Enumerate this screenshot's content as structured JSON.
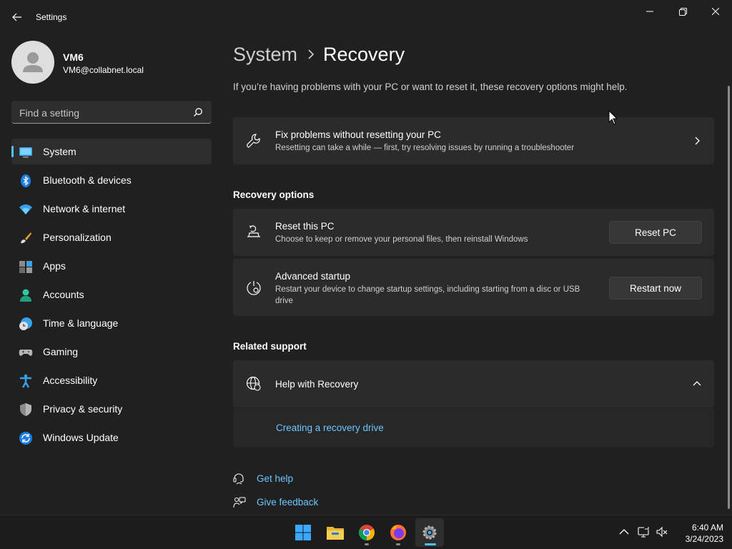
{
  "app": {
    "title": "Settings"
  },
  "profile": {
    "name": "VM6",
    "email": "VM6@collabnet.local"
  },
  "search": {
    "placeholder": "Find a setting"
  },
  "sidebar": {
    "items": [
      {
        "label": "System",
        "icon": "system-icon",
        "active": true
      },
      {
        "label": "Bluetooth & devices",
        "icon": "bluetooth-icon"
      },
      {
        "label": "Network & internet",
        "icon": "wifi-icon"
      },
      {
        "label": "Personalization",
        "icon": "brush-icon"
      },
      {
        "label": "Apps",
        "icon": "apps-icon"
      },
      {
        "label": "Accounts",
        "icon": "accounts-icon"
      },
      {
        "label": "Time & language",
        "icon": "clock-globe-icon"
      },
      {
        "label": "Gaming",
        "icon": "gamepad-icon"
      },
      {
        "label": "Accessibility",
        "icon": "accessibility-icon"
      },
      {
        "label": "Privacy & security",
        "icon": "shield-icon"
      },
      {
        "label": "Windows Update",
        "icon": "update-icon"
      }
    ]
  },
  "breadcrumb": {
    "parent": "System",
    "current": "Recovery"
  },
  "main": {
    "intro": "If you’re having problems with your PC or want to reset it, these recovery options might help.",
    "fix_card": {
      "title": "Fix problems without resetting your PC",
      "description": "Resetting can take a while — first, try resolving issues by running a troubleshooter"
    },
    "recovery_options_heading": "Recovery options",
    "reset_card": {
      "title": "Reset this PC",
      "description": "Choose to keep or remove your personal files, then reinstall Windows",
      "button": "Reset PC"
    },
    "advanced_card": {
      "title": "Advanced startup",
      "description": "Restart your device to change startup settings, including starting from a disc or USB drive",
      "button": "Restart now"
    },
    "related_support_heading": "Related support",
    "help_card": {
      "title": "Help with Recovery",
      "link": "Creating a recovery drive"
    },
    "footer": {
      "get_help": "Get help",
      "give_feedback": "Give feedback"
    }
  },
  "taskbar": {
    "apps": [
      "start-icon",
      "file-explorer-icon",
      "chrome-icon",
      "firefox-icon",
      "settings-icon"
    ],
    "time": "6:40 AM",
    "date": "3/24/2023"
  },
  "colors": {
    "accent": "#4cc2ff",
    "link": "#6cc6ff",
    "background": "#202020",
    "card": "#2b2b2b"
  }
}
